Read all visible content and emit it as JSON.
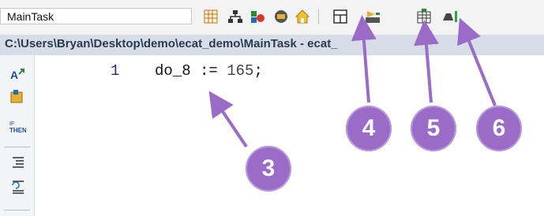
{
  "toolbar": {
    "task_select_value": "MainTask",
    "icons": [
      "variable-table-icon",
      "network-icon",
      "debug-flags-icon",
      "monitor-icon",
      "home-icon",
      "block-window-icon",
      "compile-icon",
      "download-icon",
      "run-icon"
    ]
  },
  "editor": {
    "title": "C:\\Users\\Bryan\\Desktop\\demo\\ecat_demo\\MainTask - ecat_",
    "line_number": "1",
    "code": {
      "identifier": "do_8",
      "operator": " := ",
      "value": "165",
      "terminator": ";"
    },
    "left_panel_icons": [
      "auto-format-icon",
      "insert-function-icon",
      "if-then-icon",
      "indent-icon",
      "outdent-icon"
    ],
    "if_then_label": [
      "IF",
      "THEN"
    ]
  },
  "callouts": [
    "3",
    "4",
    "5",
    "6"
  ],
  "colors": {
    "callout_fill": "#9a6cc8",
    "arrow": "#9a6cc8",
    "titlebar": "#d6dde8"
  }
}
